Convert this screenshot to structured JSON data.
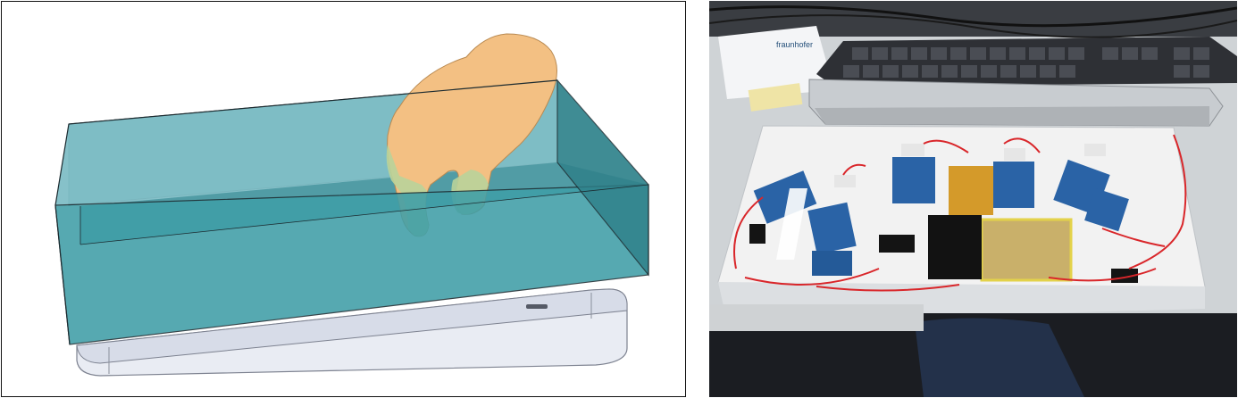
{
  "figure": {
    "left_panel": {
      "kind": "3d-render",
      "subject": "hand-over-tray",
      "colors": {
        "volume_fill": "#3f9ea7",
        "volume_top": "#6fb7c1",
        "hand": "#f3c083",
        "fingertips": "#b9d39a",
        "tray": "#dfe4ee"
      }
    },
    "right_panel": {
      "kind": "photo",
      "subject": "sensor-boards-under-keyboard",
      "document_text": "fraunhofer",
      "colors": {
        "board": "#2a63a6",
        "wire": "#d9262a",
        "battery": "#c9b06a",
        "keyboard": "#2e3035",
        "tray": "#f2f2f2"
      }
    }
  }
}
